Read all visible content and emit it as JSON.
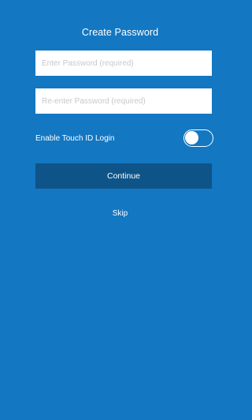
{
  "header": {
    "title": "Create Password"
  },
  "form": {
    "password": {
      "value": "",
      "placeholder": "Enter Password (required)"
    },
    "confirm_password": {
      "value": "",
      "placeholder": "Re-enter Password (required)"
    },
    "touch_id": {
      "label": "Enable Touch ID Login",
      "enabled": false
    },
    "continue_label": "Continue",
    "skip_label": "Skip"
  },
  "colors": {
    "background": "#1377c2",
    "button": "#0e5488",
    "field": "#ffffff",
    "text": "#ffffff"
  },
  "icons": {
    "toggle": "toggle-switch-off-icon"
  }
}
